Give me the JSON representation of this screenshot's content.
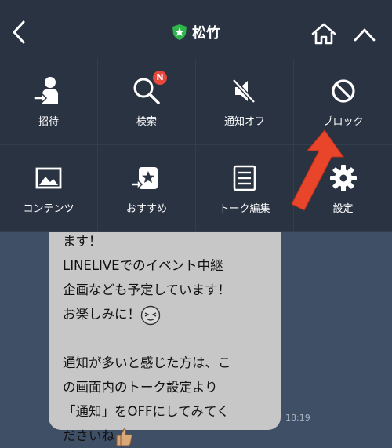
{
  "header": {
    "title": "松竹",
    "back_icon": "chevron-left-icon",
    "verified_icon": "shield-star-icon",
    "home_icon": "home-icon",
    "collapse_icon": "chevron-up-icon"
  },
  "menu": {
    "items": [
      {
        "label": "招待",
        "icon": "invite-person-icon"
      },
      {
        "label": "検索",
        "icon": "search-icon",
        "badge": "N"
      },
      {
        "label": "通知オフ",
        "icon": "speaker-mute-icon"
      },
      {
        "label": "ブロック",
        "icon": "block-icon"
      },
      {
        "label": "コンテンツ",
        "icon": "image-icon"
      },
      {
        "label": "おすすめ",
        "icon": "recommend-icon"
      },
      {
        "label": "トーク編集",
        "icon": "edit-list-icon"
      },
      {
        "label": "設定",
        "icon": "gear-icon"
      }
    ]
  },
  "message": {
    "line1": "ます！",
    "line2": "LINELIVEでのイベント中継",
    "line3": "企画なども予定しています！",
    "line4": "お楽しみに！",
    "line5": "",
    "line6": "通知が多いと感じた方は、こ",
    "line7": "の画面内のトーク設定より",
    "line8": "「通知」をOFFにしてみてく",
    "line9": "ださいね",
    "time": "18:19"
  },
  "colors": {
    "header_bg": "#2a3342",
    "chat_bg": "#3f4f66",
    "bubble": "#c7c7c7",
    "badge": "#e8473b",
    "arrow": "#e8452a",
    "verified": "#2fb54a"
  }
}
